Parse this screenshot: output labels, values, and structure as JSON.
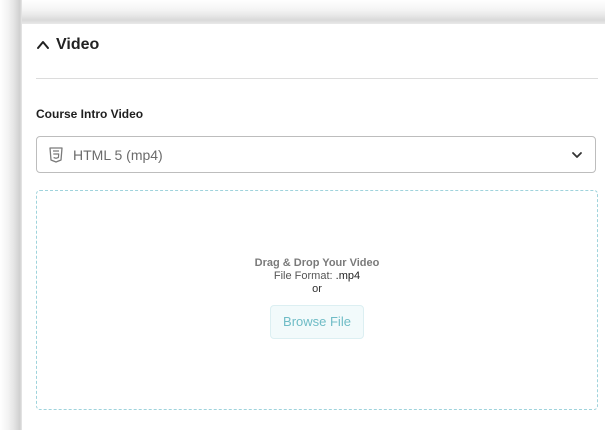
{
  "section": {
    "title": "Video",
    "collapse_icon": "chevron-up-icon"
  },
  "field": {
    "label": "Course Intro Video"
  },
  "video_source": {
    "selected": "HTML 5 (mp4)",
    "icon": "html5-icon",
    "toggle_icon": "chevron-down-icon"
  },
  "dropzone": {
    "title": "Drag & Drop Your Video",
    "format_prefix": "File Format:",
    "format_ext": ".mp4",
    "or_text": "or",
    "browse_label": "Browse File"
  },
  "colors": {
    "dropzone_border": "#9fd3dc",
    "browse_text": "#6fbcc6",
    "browse_bg": "#f2fafb"
  }
}
